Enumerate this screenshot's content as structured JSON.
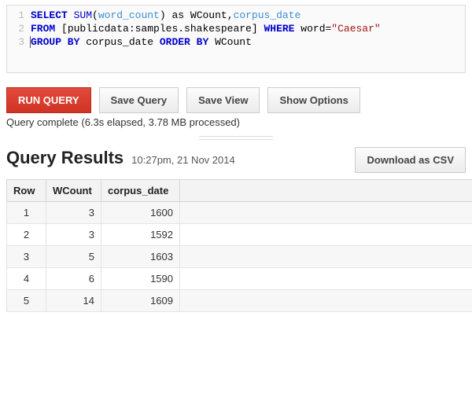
{
  "editor": {
    "lines": [
      "1",
      "2",
      "3"
    ],
    "tokens": {
      "select": "SELECT",
      "sum": "SUM",
      "lp": "(",
      "word_count": "word_count",
      "rp": ")",
      "as": " as ",
      "wcount_alias": "WCount",
      "comma": ",",
      "corpus_date": "corpus_date",
      "from": "FROM",
      "table": " [publicdata:samples.shakespeare] ",
      "where": "WHERE",
      "word_eq": " word=",
      "caesar": "\"Caesar\"",
      "group_by": "GROUP BY",
      "corpus_date2": " corpus_date ",
      "order_by": "ORDER BY",
      "wcount2": " WCount"
    }
  },
  "toolbar": {
    "run": "RUN QUERY",
    "save_query": "Save Query",
    "save_view": "Save View",
    "show_options": "Show Options"
  },
  "status": "Query complete (6.3s elapsed, 3.78 MB processed)",
  "results": {
    "title": "Query Results",
    "timestamp": "10:27pm, 21 Nov 2014",
    "download": "Download as CSV",
    "columns": {
      "row": "Row",
      "wcount": "WCount",
      "corpus_date": "corpus_date"
    },
    "rows": [
      {
        "n": "1",
        "wcount": "3",
        "corpus_date": "1600"
      },
      {
        "n": "2",
        "wcount": "3",
        "corpus_date": "1592"
      },
      {
        "n": "3",
        "wcount": "5",
        "corpus_date": "1603"
      },
      {
        "n": "4",
        "wcount": "6",
        "corpus_date": "1590"
      },
      {
        "n": "5",
        "wcount": "14",
        "corpus_date": "1609"
      }
    ]
  }
}
